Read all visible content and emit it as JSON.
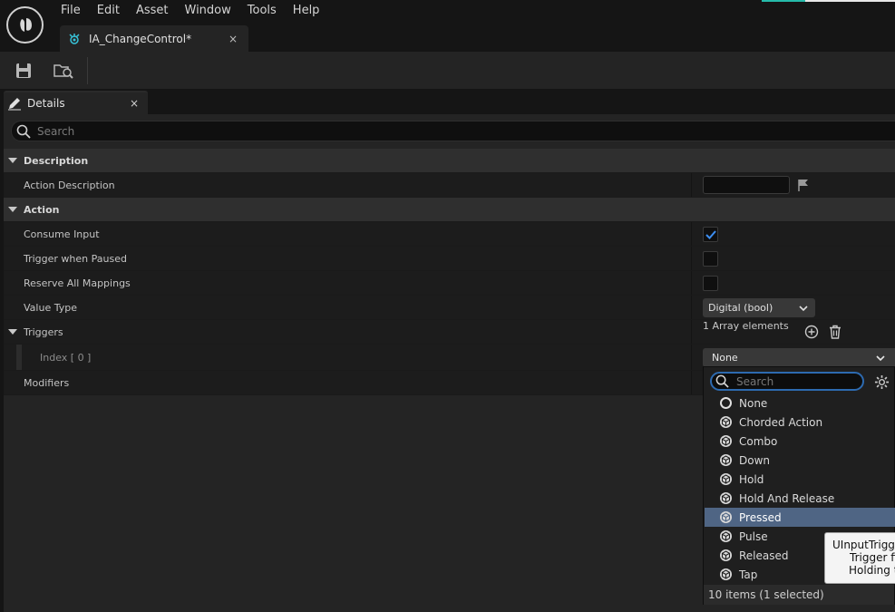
{
  "menu": {
    "items": [
      "File",
      "Edit",
      "Asset",
      "Window",
      "Tools",
      "Help"
    ]
  },
  "document_tab": {
    "label": "IA_ChangeControl*",
    "close": "×"
  },
  "details_tab": {
    "label": "Details",
    "close": "×"
  },
  "search": {
    "placeholder": "Search"
  },
  "categories": {
    "description": "Description",
    "action": "Action"
  },
  "properties": {
    "action_description": "Action Description",
    "consume_input": {
      "label": "Consume Input",
      "checked": true
    },
    "trigger_when_paused": {
      "label": "Trigger when Paused",
      "checked": false
    },
    "reserve_all_mappings": {
      "label": "Reserve All Mappings",
      "checked": false
    },
    "value_type": {
      "label": "Value Type",
      "value": "Digital (bool)"
    },
    "triggers": {
      "label": "Triggers",
      "array_text": "1 Array elements"
    },
    "index0": {
      "label": "Index [ 0 ]",
      "value": "None"
    },
    "modifiers": {
      "label": "Modifiers"
    }
  },
  "dropdown": {
    "search_placeholder": "Search",
    "options": [
      {
        "label": "None",
        "icon": "circle-outline-icon"
      },
      {
        "label": "Chorded Action",
        "icon": "trigger-class-icon"
      },
      {
        "label": "Combo",
        "icon": "trigger-class-icon"
      },
      {
        "label": "Down",
        "icon": "trigger-class-icon"
      },
      {
        "label": "Hold",
        "icon": "trigger-class-icon"
      },
      {
        "label": "Hold And Release",
        "icon": "trigger-class-icon"
      },
      {
        "label": "Pressed",
        "icon": "trigger-class-icon",
        "selected": true
      },
      {
        "label": "Pulse",
        "icon": "trigger-class-icon"
      },
      {
        "label": "Released",
        "icon": "trigger-class-icon"
      },
      {
        "label": "Tap",
        "icon": "trigger-class-icon"
      }
    ],
    "footer": "10 items (1 selected)"
  },
  "tooltip": {
    "lines": [
      "UInputTrigge",
      "Trigger fir",
      "Holding th"
    ]
  },
  "colors": {
    "accent_teal": "#26bbaa",
    "selection": "#4f6584",
    "focus_blue": "#2d6ab0",
    "checkmark": "#3d8ef0"
  }
}
